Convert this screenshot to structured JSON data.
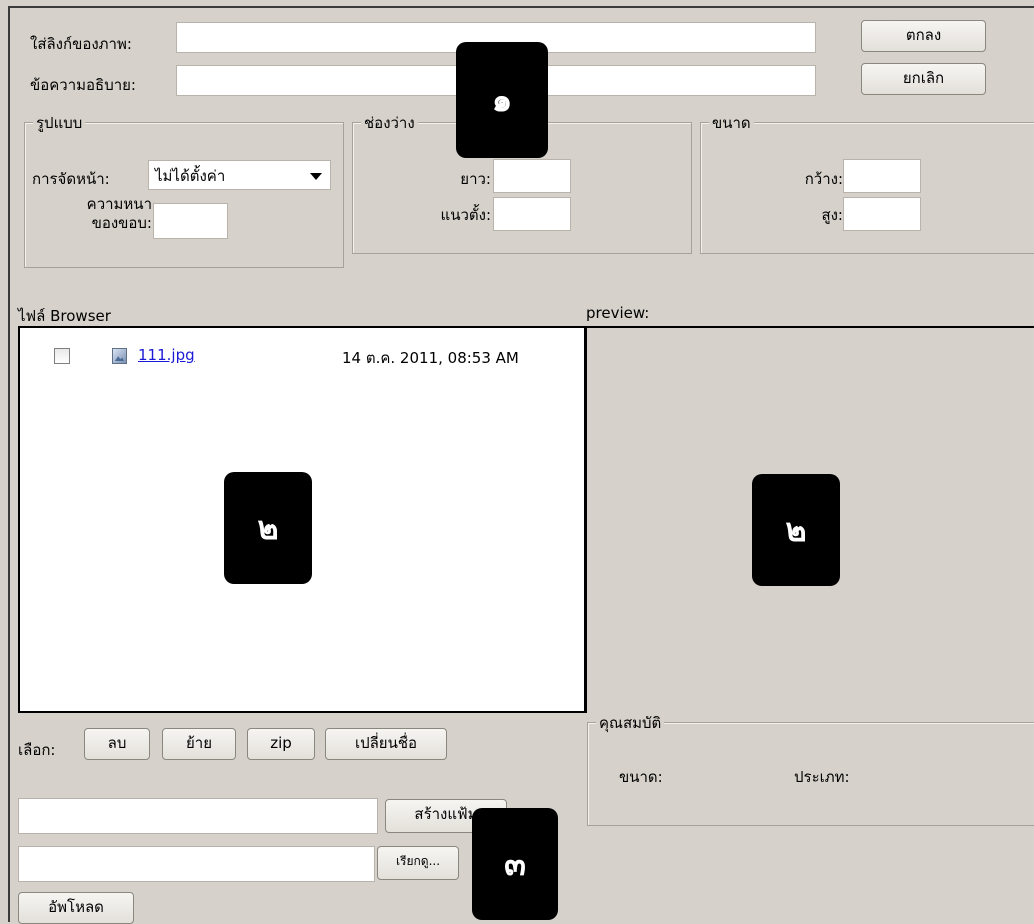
{
  "top": {
    "image_link_label": "ใส่ลิงก์ของภาพ:",
    "image_link_value": "",
    "description_label": "ข้อความอธิบาย:",
    "description_value": "",
    "ok_button": "ตกลง",
    "cancel_button": "ยกเลิก"
  },
  "format_group": {
    "legend": "รูปแบบ",
    "align_label": "การจัดหน้า:",
    "align_selected": "ไม่ได้ตั้งค่า",
    "border_label_line1": "ความหนา",
    "border_label_line2": "ของขอบ:",
    "border_value": ""
  },
  "spacing_group": {
    "legend": "ช่องว่าง",
    "horizontal_label": "ยาว:",
    "horizontal_value": "",
    "vertical_label": "แนวตั้ง:",
    "vertical_value": ""
  },
  "size_group": {
    "legend": "ขนาด",
    "width_label": "กว้าง:",
    "width_value": "",
    "height_label": "สูง:",
    "height_value": ""
  },
  "file_browser": {
    "title": "ไฟล์ Browser",
    "files": [
      {
        "name": "111.jpg",
        "date": "14 ต.ค. 2011, 08:53 AM"
      }
    ]
  },
  "preview": {
    "title": "preview:"
  },
  "actions": {
    "select_label": "เลือก:",
    "delete_button": "ลบ",
    "move_button": "ย้าย",
    "zip_button": "zip",
    "rename_button": "เปลี่ยนชื่อ"
  },
  "create_folder": {
    "value": "",
    "button": "สร้างแฟ้ม"
  },
  "upload": {
    "file_value": "",
    "browse_button": "เรียกดู...",
    "upload_button": "อัพโหลด"
  },
  "properties": {
    "legend": "คุณสมบัติ",
    "size_label": "ขนาด:",
    "type_label": "ประเภท:"
  },
  "callouts": [
    "๑",
    "๒",
    "๒",
    "๓"
  ]
}
